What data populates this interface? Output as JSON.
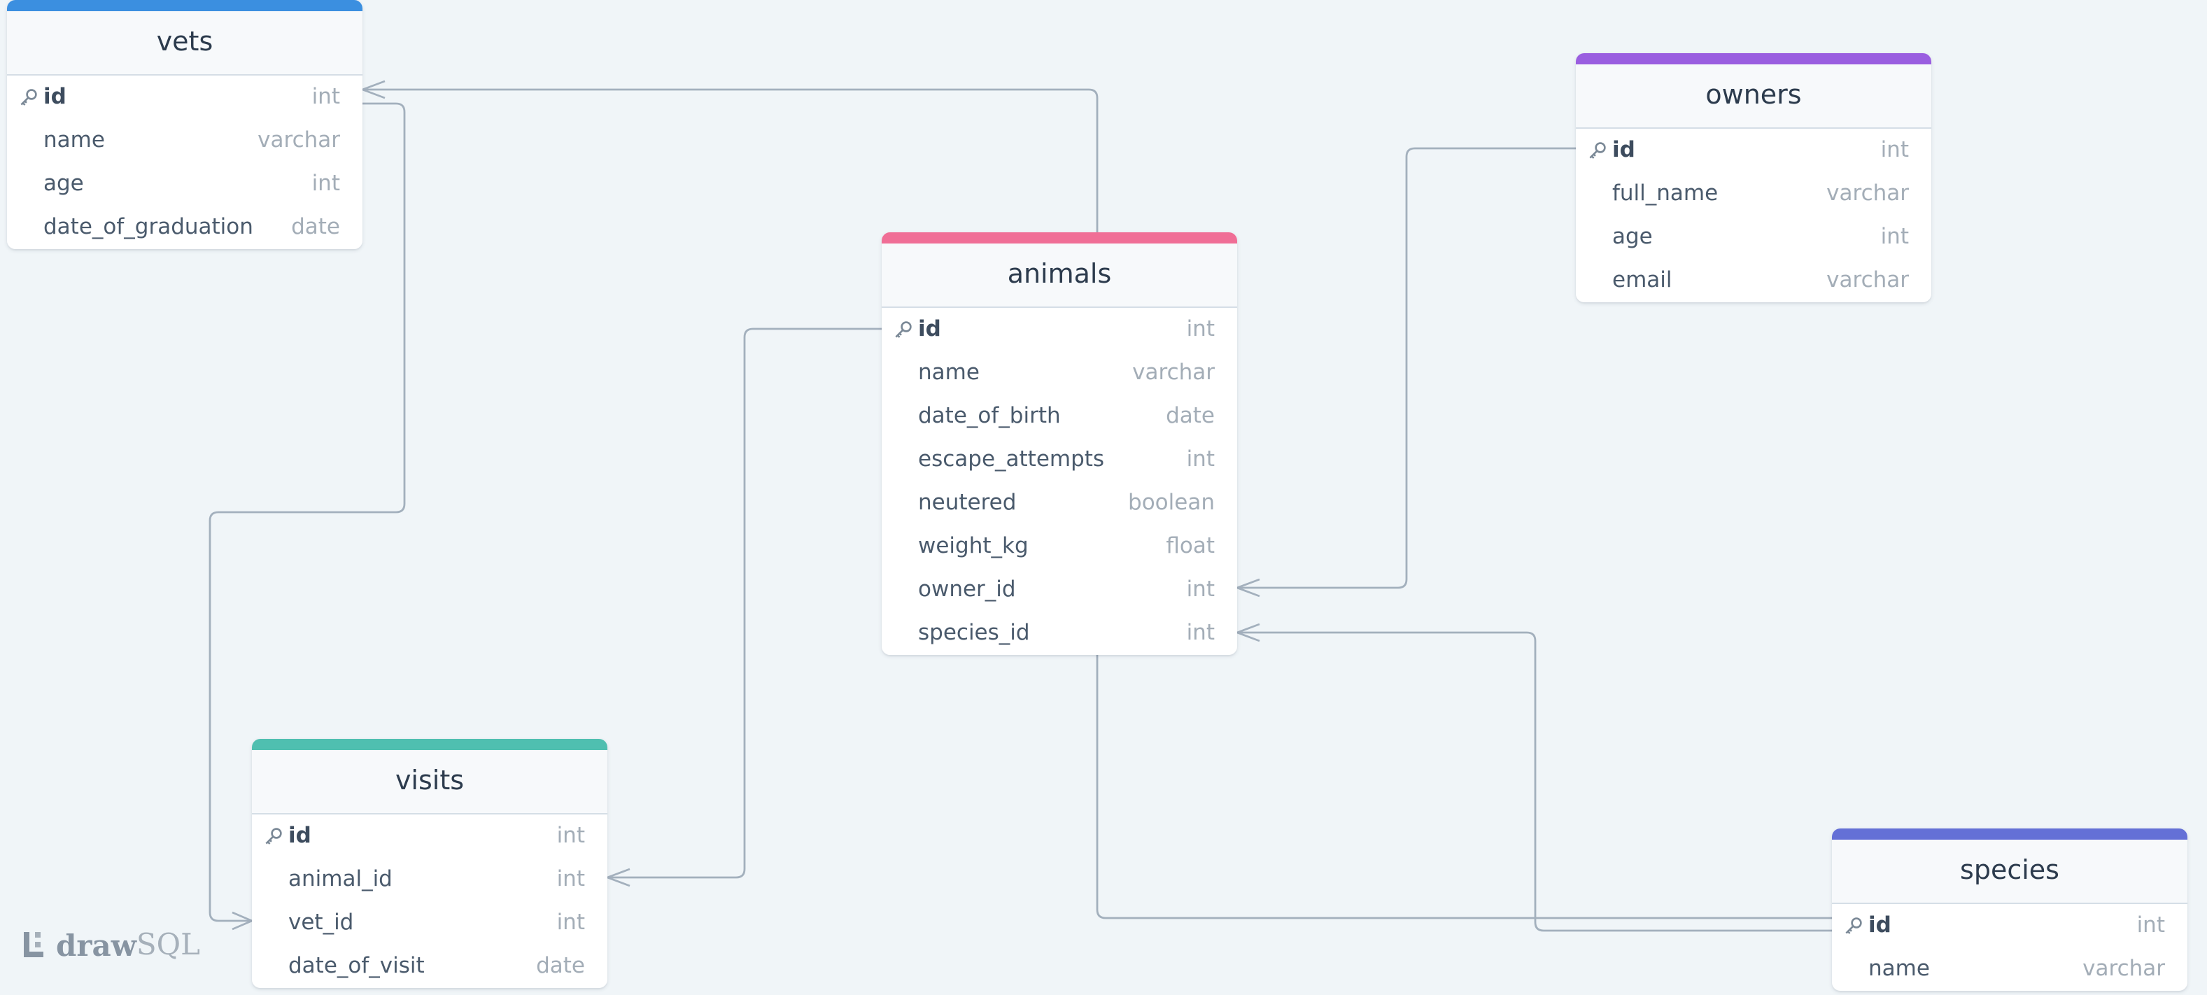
{
  "tables": {
    "vets": {
      "name": "vets",
      "color": "#3b8fe0",
      "columns": [
        {
          "name": "id",
          "type": "int"
        },
        {
          "name": "name",
          "type": "varchar"
        },
        {
          "name": "age",
          "type": "int"
        },
        {
          "name": "date_of_graduation",
          "type": "date"
        }
      ]
    },
    "animals": {
      "name": "animals",
      "color": "#f06e96",
      "columns": [
        {
          "name": "id",
          "type": "int"
        },
        {
          "name": "name",
          "type": "varchar"
        },
        {
          "name": "date_of_birth",
          "type": "date"
        },
        {
          "name": "escape_attempts",
          "type": "int"
        },
        {
          "name": "neutered",
          "type": "boolean"
        },
        {
          "name": "weight_kg",
          "type": "float"
        },
        {
          "name": "owner_id",
          "type": "int"
        },
        {
          "name": "species_id",
          "type": "int"
        }
      ]
    },
    "owners": {
      "name": "owners",
      "color": "#9a5ee0",
      "columns": [
        {
          "name": "id",
          "type": "int"
        },
        {
          "name": "full_name",
          "type": "varchar"
        },
        {
          "name": "age",
          "type": "int"
        },
        {
          "name": "email",
          "type": "varchar"
        }
      ]
    },
    "visits": {
      "name": "visits",
      "color": "#4fbfb0",
      "columns": [
        {
          "name": "id",
          "type": "int"
        },
        {
          "name": "animal_id",
          "type": "int"
        },
        {
          "name": "vet_id",
          "type": "int"
        },
        {
          "name": "date_of_visit",
          "type": "date"
        }
      ]
    },
    "species": {
      "name": "species",
      "color": "#6470d6",
      "columns": [
        {
          "name": "id",
          "type": "int"
        },
        {
          "name": "name",
          "type": "varchar"
        }
      ]
    }
  },
  "relationships": [
    {
      "from": "vets.id",
      "to": "animals.id",
      "from_end": "many",
      "to_end": "one"
    },
    {
      "from": "vets.id",
      "to": "visits.vet_id",
      "from_end": "one",
      "to_end": "many"
    },
    {
      "from": "animals.id",
      "to": "visits.animal_id",
      "from_end": "one",
      "to_end": "many"
    },
    {
      "from": "owners.id",
      "to": "animals.owner_id",
      "from_end": "one",
      "to_end": "many"
    },
    {
      "from": "species.id",
      "to": "animals.species_id",
      "from_end": "one",
      "to_end": "many"
    },
    {
      "from": "species.id",
      "to": "animals.id",
      "from_end": "one",
      "to_end": "one"
    }
  ],
  "brand": {
    "word_bold": "draw",
    "word_light": "SQL",
    "logo_icon": "drawsql-logo-icon"
  },
  "colors": {
    "background": "#f0f5f8",
    "connector": "#a3b0bd",
    "primary_key_icon": "key-icon"
  }
}
